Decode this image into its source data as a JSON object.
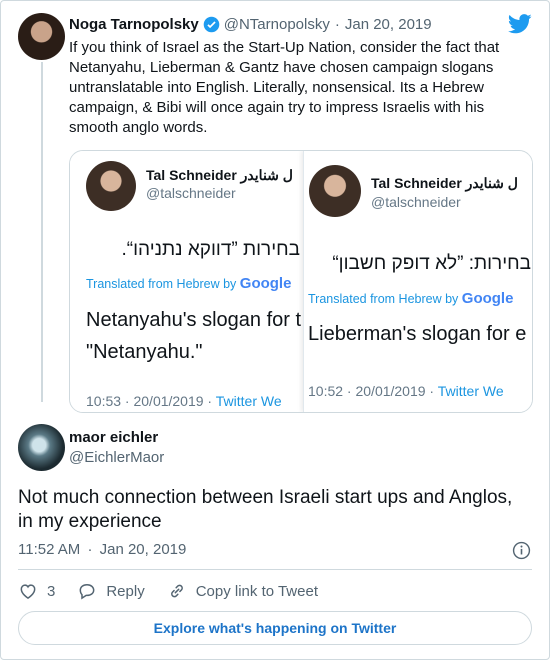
{
  "tweet": {
    "author_name": "Noga Tarnopolsky",
    "handle": "@NTarnopolsky",
    "separator": "·",
    "date": "Jan 20, 2019",
    "text": "If you think of Israel as the Start-Up Nation, consider the fact that Netanyahu, Lieberman & Gantz have chosen campaign slogans untranslatable into English. Literally, nonsensical. Its a Hebrew campaign, & Bibi will once again try to impress Israelis with his smooth anglo words."
  },
  "embedded_screenshots": [
    {
      "name": "Tal Schneider ل شنايدر",
      "handle": "@talschneider",
      "hebrew": "בחירות ”דווקא נתניהו“.",
      "translated_label": "Translated from Hebrew by",
      "google": "Google",
      "translation_line1": "Netanyahu's slogan for t",
      "translation_line2": "\"Netanyahu.\"",
      "timestamp": "10:53 · 20/01/2019 ·",
      "source": "Twitter We"
    },
    {
      "name": "Tal Schneider ل شنايدر",
      "handle": "@talschneider",
      "hebrew": "בחירות: ”לא דופק חשבון“",
      "translated_label": "Translated from Hebrew by",
      "google": "Google",
      "translation_line1": "Lieberman's slogan for e",
      "timestamp": "10:52 · 20/01/2019 ·",
      "source": "Twitter We"
    }
  ],
  "reply": {
    "author_name": "maor eichler",
    "handle": "@EichlerMaor",
    "text": "Not much connection between Israeli start ups and Anglos, in my experience",
    "time": "11:52 AM",
    "separator": "·",
    "date": "Jan 20, 2019",
    "likes": "3",
    "reply_label": "Reply",
    "copy_link_label": "Copy link to Tweet"
  },
  "explore_label": "Explore what's happening on Twitter",
  "colors": {
    "twitter_blue": "#1d9bf0",
    "like_red": "#f91880",
    "text_muted": "#536471",
    "border": "#cfd9de"
  }
}
